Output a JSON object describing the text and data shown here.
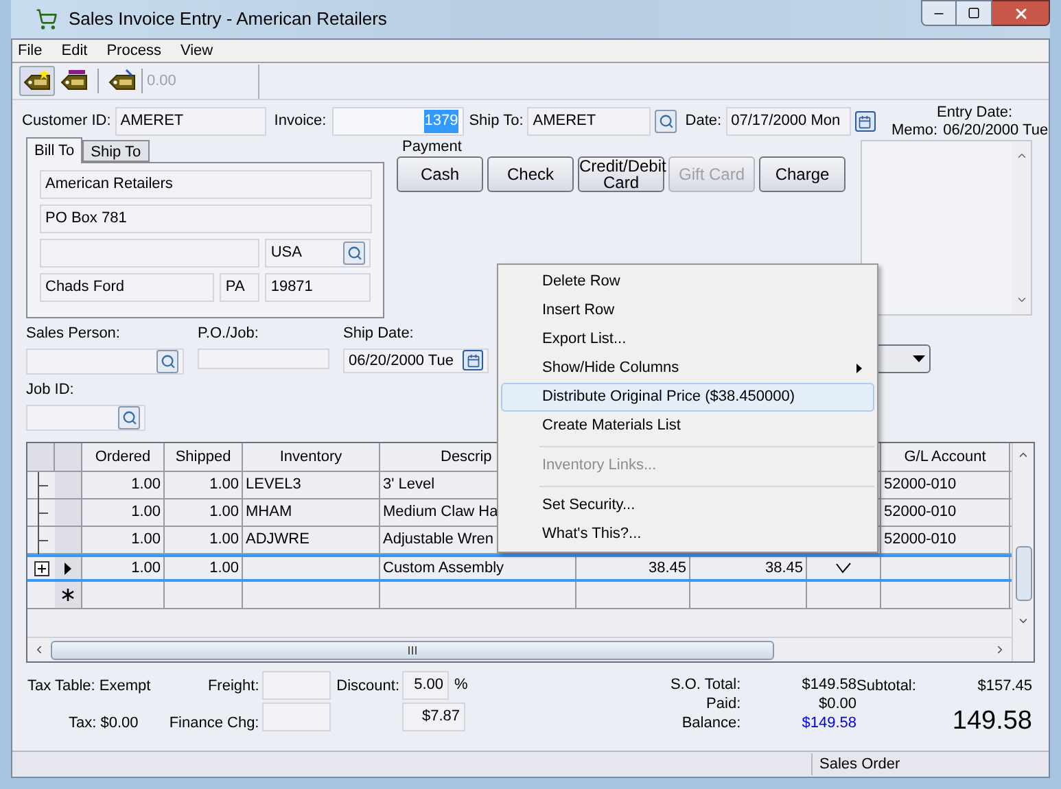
{
  "window": {
    "title": "Sales Invoice Entry - American Retailers"
  },
  "menu": [
    "File",
    "Edit",
    "Process",
    "View"
  ],
  "toolbar": {
    "amount": "0.00"
  },
  "header": {
    "customer_id": {
      "label": "Customer ID:",
      "value": "AMERET"
    },
    "invoice": {
      "label": "Invoice:",
      "value": "1379"
    },
    "ship_to": {
      "label": "Ship To:",
      "value": "AMERET"
    },
    "date": {
      "label": "Date:",
      "value": "07/17/2000 Mon"
    },
    "entry_date": {
      "label": "Entry Date:",
      "value": "06/20/2000 Tue"
    },
    "memo_label": "Memo:"
  },
  "address_tabs": [
    {
      "label": "Bill To",
      "selected": true
    },
    {
      "label": "Ship To",
      "selected": false
    }
  ],
  "address": {
    "name": "American Retailers",
    "line1": "PO Box 781",
    "country": "USA",
    "city": "Chads Ford",
    "state": "PA",
    "zip": "19871"
  },
  "payment": {
    "label": "Payment",
    "buttons": [
      {
        "label": "Cash",
        "disabled": false
      },
      {
        "label": "Check",
        "disabled": false
      },
      {
        "label": "Credit/Debit Card",
        "disabled": false
      },
      {
        "label": "Gift Card",
        "disabled": true
      },
      {
        "label": "Charge",
        "disabled": false
      }
    ]
  },
  "sales_person": {
    "label": "Sales Person:"
  },
  "po_job": {
    "label": "P.O./Job:"
  },
  "ship_date": {
    "label": "Ship Date:",
    "value": "06/20/2000 Tue"
  },
  "job_id": {
    "label": "Job ID:"
  },
  "grid": {
    "columns": {
      "ordered": "Ordered",
      "shipped": "Shipped",
      "inventory": "Inventory",
      "description": "Descrip",
      "gl_account": "G/L Account"
    },
    "rows": [
      {
        "kind": "child",
        "selected": false,
        "ordered": "1.00",
        "shipped": "1.00",
        "inventory": "LEVEL3",
        "description": "3' Level",
        "gl_account": "52000-010"
      },
      {
        "kind": "child",
        "selected": false,
        "ordered": "1.00",
        "shipped": "1.00",
        "inventory": "MHAM",
        "description": "Medium Claw Ha",
        "gl_account": "52000-010"
      },
      {
        "kind": "child",
        "selected": false,
        "ordered": "1.00",
        "shipped": "1.00",
        "inventory": "ADJWRE",
        "description": "Adjustable Wren",
        "gl_account": "52000-010"
      },
      {
        "kind": "parent",
        "selected": true,
        "expanded": false,
        "ordered": "1.00",
        "shipped": "1.00",
        "description": "Custom Assembly",
        "column_5": "38.45",
        "column_6": "38.45",
        "column_7_checked": true
      },
      {
        "kind": "new",
        "selected": false
      }
    ]
  },
  "context_menu": [
    {
      "kind": "item",
      "label": "Delete Row",
      "disabled": false,
      "selected": false,
      "submenu": false
    },
    {
      "kind": "item",
      "label": "Insert Row",
      "disabled": false,
      "selected": false,
      "submenu": false
    },
    {
      "kind": "item",
      "label": "Export List...",
      "disabled": false,
      "selected": false,
      "submenu": false
    },
    {
      "kind": "item",
      "label": "Show/Hide Columns",
      "disabled": false,
      "selected": false,
      "submenu": true
    },
    {
      "kind": "item",
      "label": "Distribute Original Price ($38.450000)",
      "disabled": false,
      "selected": true,
      "submenu": false
    },
    {
      "kind": "item",
      "label": "Create Materials List",
      "disabled": false,
      "selected": false,
      "submenu": false
    },
    {
      "kind": "separator"
    },
    {
      "kind": "item",
      "label": "Inventory Links...",
      "disabled": true,
      "selected": false,
      "submenu": false
    },
    {
      "kind": "separator"
    },
    {
      "kind": "item",
      "label": "Set Security...",
      "disabled": false,
      "selected": false,
      "submenu": false
    },
    {
      "kind": "item",
      "label": "What's This?...",
      "disabled": false,
      "selected": false,
      "submenu": false
    }
  ],
  "totals": {
    "tax_table": "Tax Table: Exempt",
    "tax": "Tax: $0.00",
    "freight_label": "Freight:",
    "finance_label": "Finance Chg:",
    "discount_label": "Discount:",
    "discount_percent": "5.00",
    "percent_sign": "%",
    "discount_amount": "$7.87",
    "so_total_label": "S.O. Total:",
    "so_total": "$149.58",
    "paid_label": "Paid:",
    "paid": "$0.00",
    "balance_label": "Balance:",
    "balance": "$149.58",
    "subtotal_label": "Subtotal:",
    "subtotal": "$157.45",
    "grand_total": "149.58"
  },
  "status_bar": {
    "text": "Sales Order"
  }
}
